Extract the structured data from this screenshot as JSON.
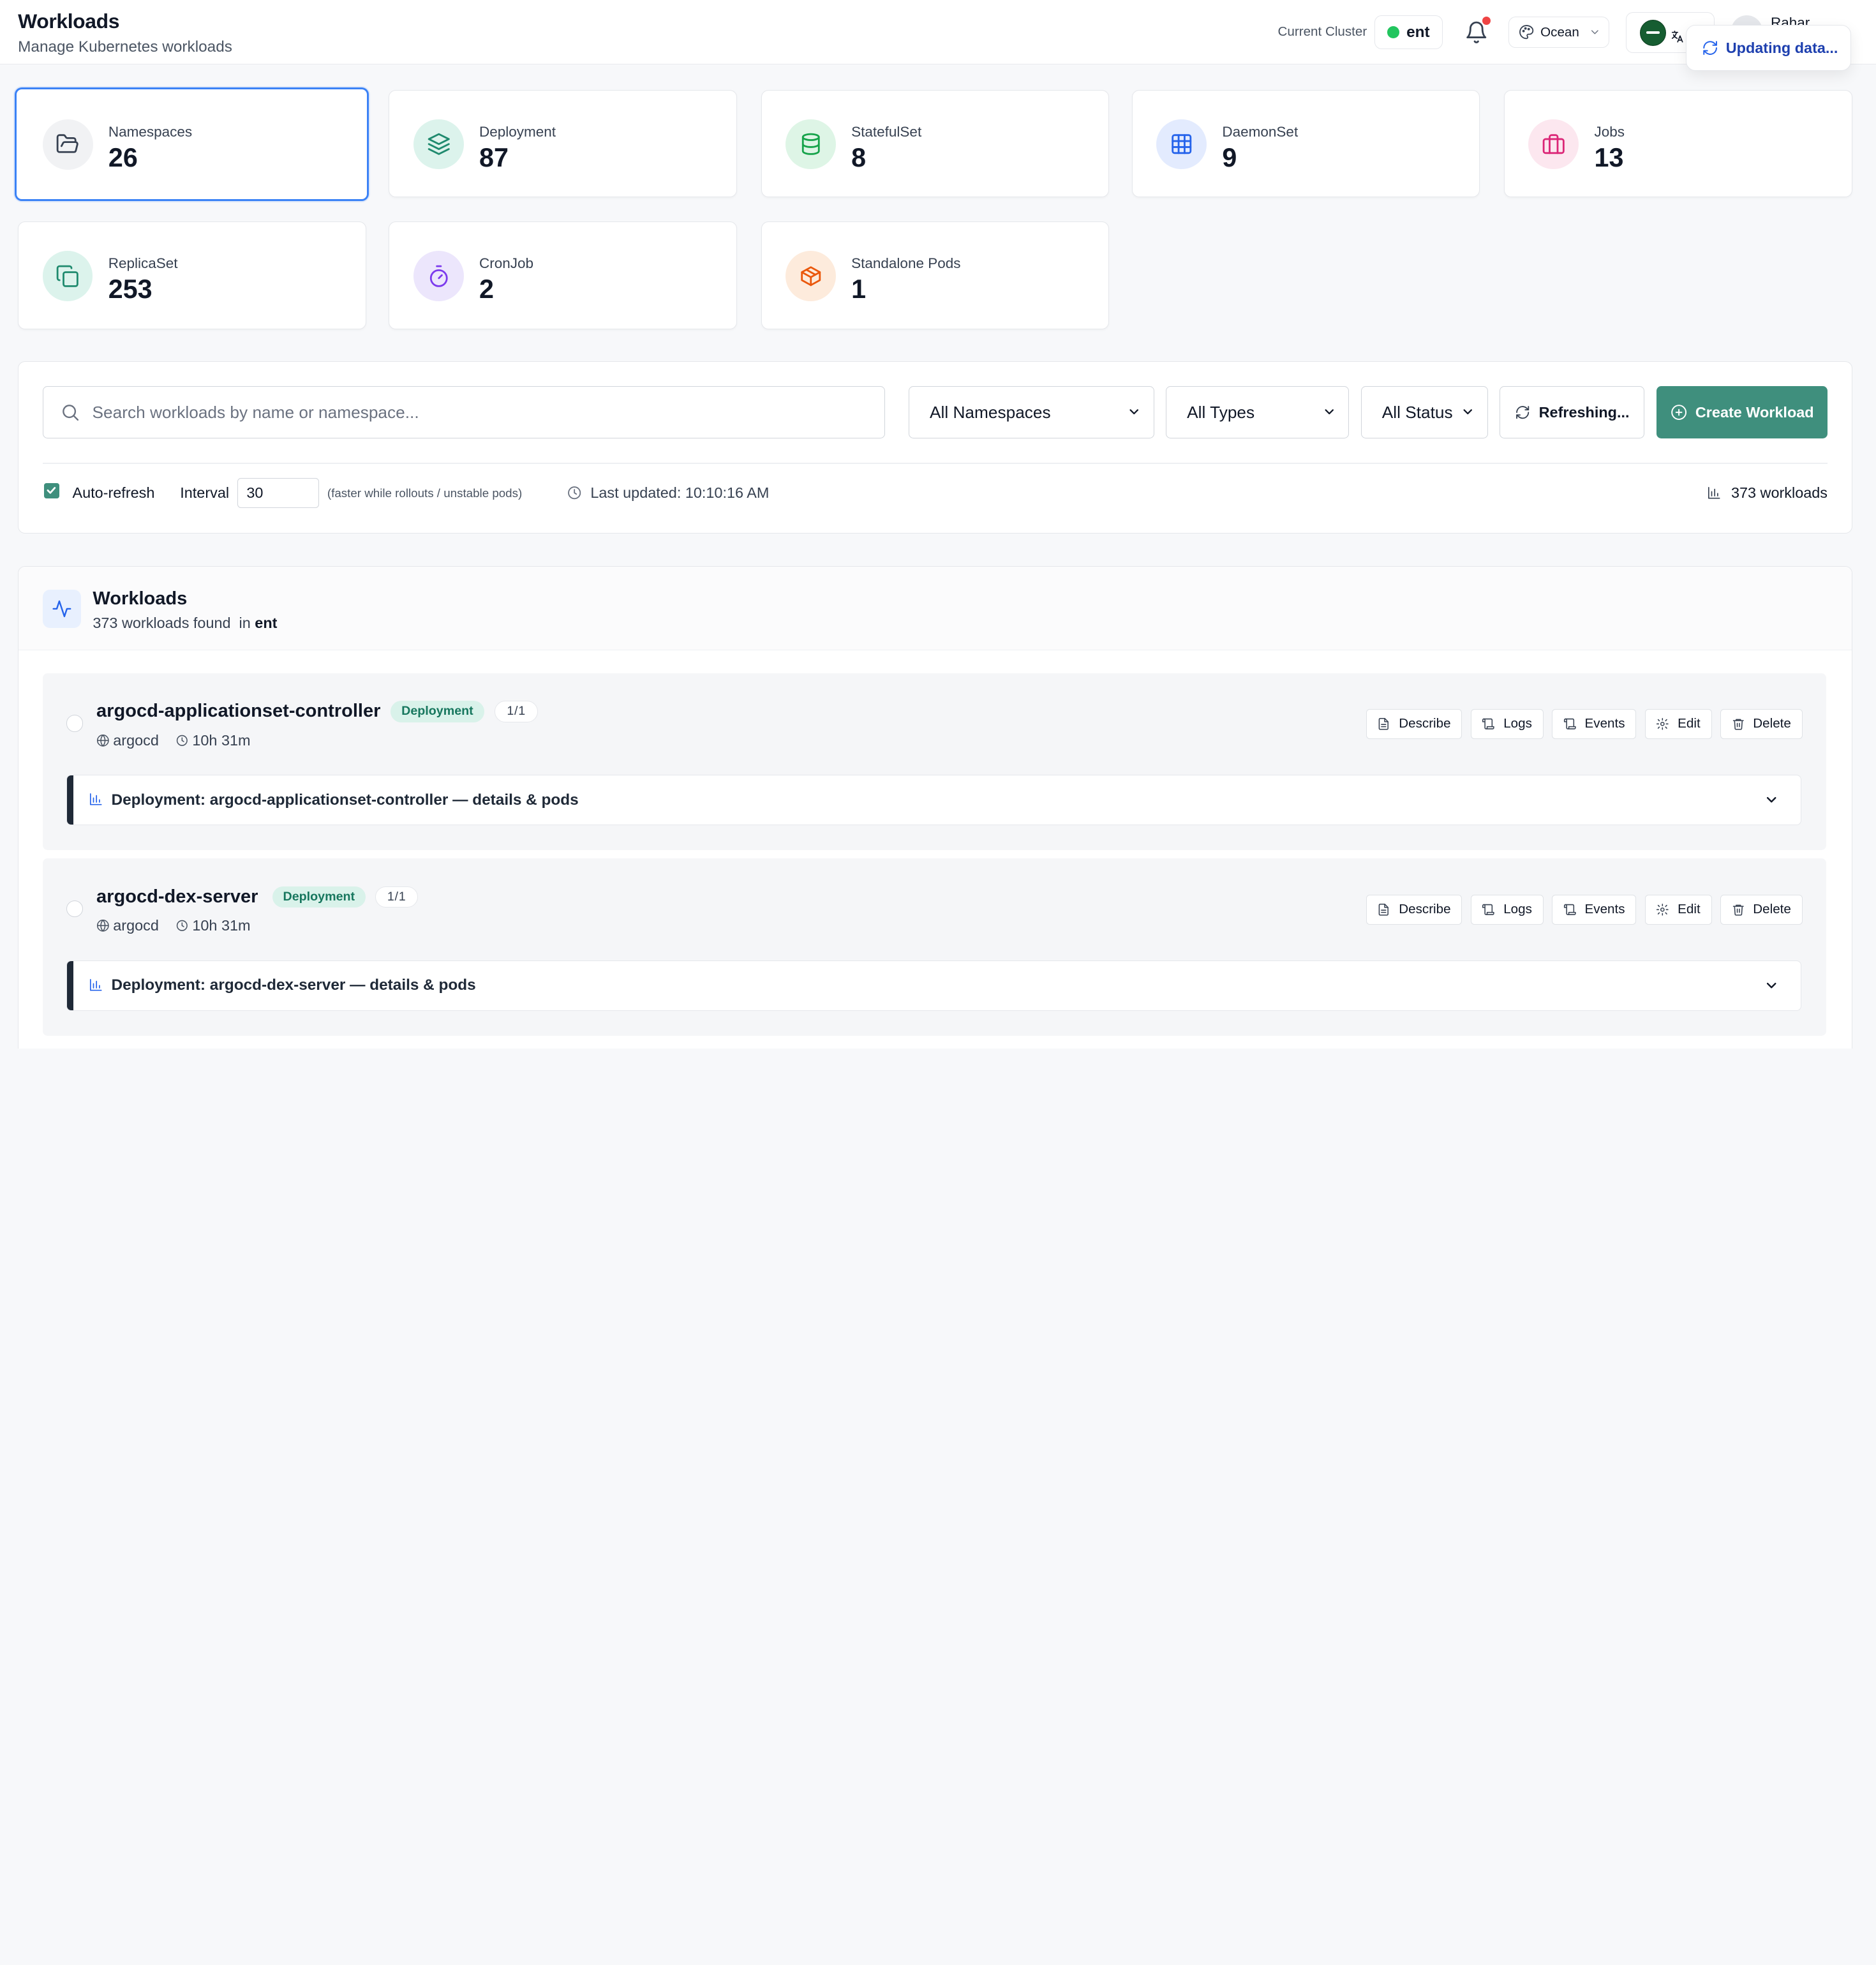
{
  "header": {
    "title": "Workloads",
    "subtitle": "Manage Kubernetes workloads",
    "cluster_label": "Current Cluster",
    "cluster_name": "ent",
    "theme": "Ocean",
    "user_name": "Rahar",
    "toast": "Updating data..."
  },
  "stats": [
    {
      "label": "Namespaces",
      "value": "26",
      "icon": "folder-open-icon",
      "icon_bg": "#f1f2f4",
      "icon_color": "#374151",
      "active": true
    },
    {
      "label": "Deployment",
      "value": "87",
      "icon": "layers-icon",
      "icon_bg": "#dcf3ec",
      "icon_color": "#1f8a6e"
    },
    {
      "label": "StatefulSet",
      "value": "8",
      "icon": "database-icon",
      "icon_bg": "#def5e6",
      "icon_color": "#16a34a"
    },
    {
      "label": "DaemonSet",
      "value": "9",
      "icon": "grid-icon",
      "icon_bg": "#e3ebfe",
      "icon_color": "#2563eb"
    },
    {
      "label": "Jobs",
      "value": "13",
      "icon": "briefcase-icon",
      "icon_bg": "#fce7ef",
      "icon_color": "#db2777"
    },
    {
      "label": "ReplicaSet",
      "value": "253",
      "icon": "copy-icon",
      "icon_bg": "#dcf3ec",
      "icon_color": "#1f8a6e"
    },
    {
      "label": "CronJob",
      "value": "2",
      "icon": "timer-icon",
      "icon_bg": "#ece6fc",
      "icon_color": "#7c3aed"
    },
    {
      "label": "Standalone Pods",
      "value": "1",
      "icon": "package-icon",
      "icon_bg": "#fdebdc",
      "icon_color": "#ea580c"
    }
  ],
  "filters": {
    "search_placeholder": "Search workloads by name or namespace...",
    "namespace": "All Namespaces",
    "type": "All Types",
    "status": "All Status",
    "refresh_label": "Refreshing...",
    "create_label": "Create Workload",
    "auto_refresh_label": "Auto-refresh",
    "auto_refresh_checked": true,
    "interval_label": "Interval",
    "interval_value": "30",
    "interval_hint": "(faster while rollouts / unstable pods)",
    "last_updated": "Last updated: 10:10:16 AM",
    "count": "373 workloads"
  },
  "list": {
    "title": "Workloads",
    "found": "373 workloads found",
    "in_label": "in",
    "cluster": "ent",
    "actions": [
      "Describe",
      "Logs",
      "Events",
      "Edit",
      "Delete"
    ],
    "items": [
      {
        "name": "argocd-applicationset-controller",
        "type": "Deployment",
        "replicas": "1/1",
        "namespace": "argocd",
        "age": "10h 31m",
        "detail": "Deployment: argocd-applicationset-controller — details & pods"
      },
      {
        "name": "argocd-dex-server",
        "type": "Deployment",
        "replicas": "1/1",
        "namespace": "argocd",
        "age": "10h 31m",
        "detail": "Deployment: argocd-dex-server — details & pods"
      }
    ]
  },
  "colors": {
    "accent": "#3f8f7d",
    "active_border": "#3b82f6",
    "online": "#22c55e",
    "notification": "#ef4444"
  }
}
